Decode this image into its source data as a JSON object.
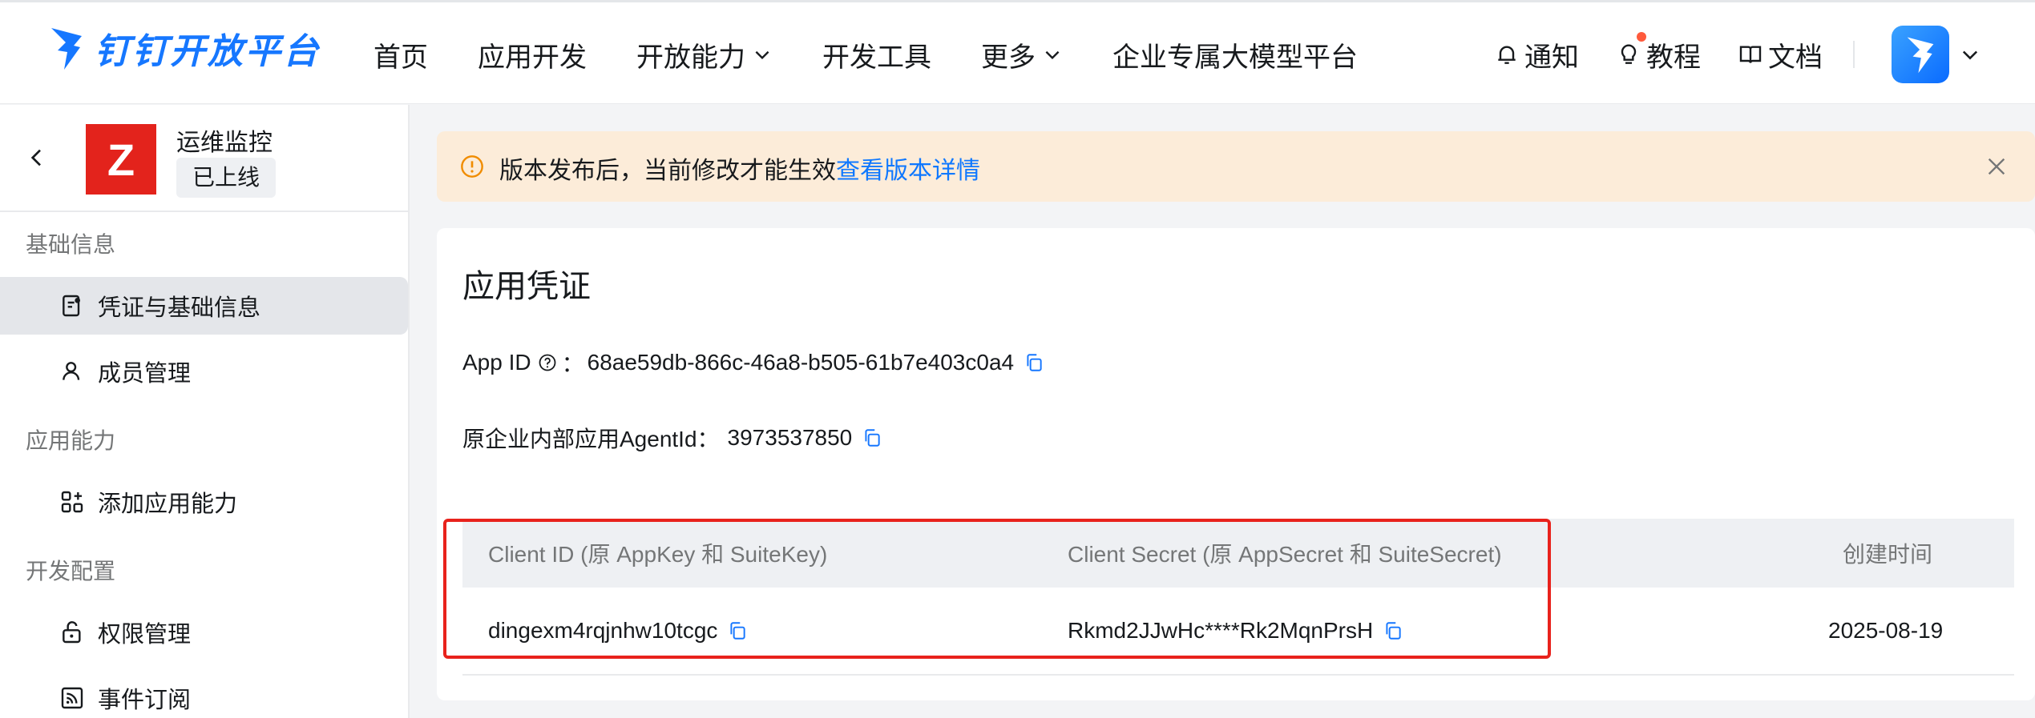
{
  "header": {
    "brand": "钉钉开放平台",
    "nav": [
      {
        "label": "首页",
        "has_dropdown": false
      },
      {
        "label": "应用开发",
        "has_dropdown": false
      },
      {
        "label": "开放能力",
        "has_dropdown": true
      },
      {
        "label": "开发工具",
        "has_dropdown": false
      },
      {
        "label": "更多",
        "has_dropdown": true
      },
      {
        "label": "企业专属大模型平台",
        "has_dropdown": false
      }
    ],
    "tools": {
      "notify": "通知",
      "tutorial": "教程",
      "docs": "文档"
    },
    "colors": {
      "brand": "#1677ff",
      "text": "#171a1d"
    }
  },
  "sidebar": {
    "app_logo_letter": "Z",
    "app_name": "运维监控",
    "app_status": "已上线",
    "groups": [
      {
        "label": "基础信息",
        "items": [
          {
            "label": "凭证与基础信息",
            "icon": "credential-icon",
            "active": true
          },
          {
            "label": "成员管理",
            "icon": "user-icon",
            "active": false
          }
        ]
      },
      {
        "label": "应用能力",
        "items": [
          {
            "label": "添加应用能力",
            "icon": "add-capability-icon",
            "active": false
          }
        ]
      },
      {
        "label": "开发配置",
        "items": [
          {
            "label": "权限管理",
            "icon": "lock-icon",
            "active": false
          },
          {
            "label": "事件订阅",
            "icon": "subscribe-icon",
            "active": false
          }
        ]
      }
    ]
  },
  "banner": {
    "text": "版本发布后，当前修改才能生效",
    "link": "查看版本详情",
    "color": "#fcecd9"
  },
  "card": {
    "title": "应用凭证",
    "app_id_label": "App ID",
    "app_id_sep": "：",
    "app_id_value": "68ae59db-866c-46a8-b505-61b7e403c0a4",
    "agent_label": "原企业内部应用AgentId：",
    "agent_value": "3973537850",
    "table": {
      "columns": [
        "Client ID (原 AppKey 和 SuiteKey)",
        "Client Secret (原 AppSecret 和 SuiteSecret)",
        "创建时间"
      ],
      "rows": [
        {
          "client_id": "dingexm4rqjnhw10tcgc",
          "client_secret": "Rkmd2JJwHc****Rk2MqnPrsH",
          "created": "2025-08-19"
        }
      ]
    },
    "highlight_color": "#e8221c"
  }
}
